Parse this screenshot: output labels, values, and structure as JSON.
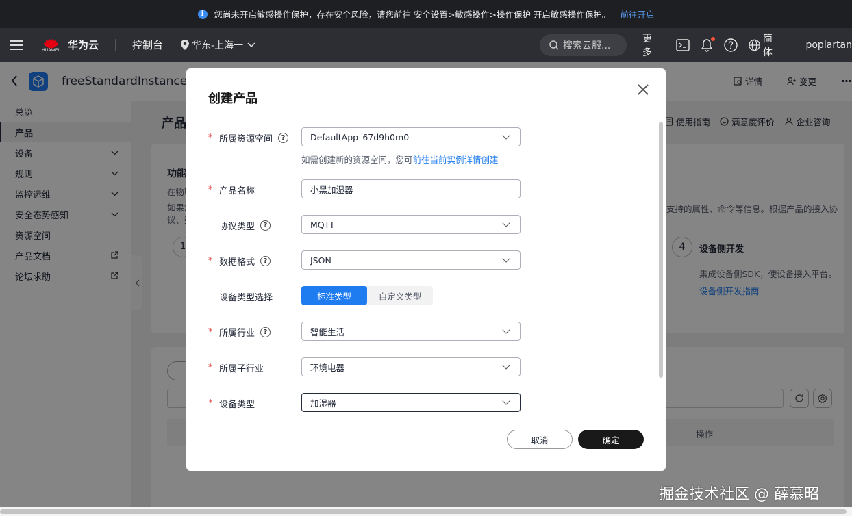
{
  "banner": {
    "message": "您尚未开启敏感操作保护，存在安全风险，请您前往 安全设置>敏感操作>操作保护 开启敏感操作保护。",
    "link": "前往开启",
    "accent": "#5b9cf2"
  },
  "nav": {
    "logo_text": "HUAWEI",
    "brand": "华为云",
    "console": "控制台",
    "region": "华东-上海一",
    "search_placeholder": "搜索云服...",
    "more": "更多",
    "language": "简体",
    "user": "poplartan"
  },
  "subheader": {
    "instance_name": "freeStandardInstance",
    "detail": "详情",
    "change": "变更"
  },
  "sidebar": {
    "items": [
      {
        "label": "总览"
      },
      {
        "label": "产品"
      },
      {
        "label": "设备"
      },
      {
        "label": "规则"
      },
      {
        "label": "监控运维"
      },
      {
        "label": "安全态势感知"
      },
      {
        "label": "资源空间"
      },
      {
        "label": "产品文档"
      },
      {
        "label": "论坛求助"
      }
    ]
  },
  "main": {
    "title": "产品",
    "links": [
      "使用指南",
      "满意度评价",
      "企业咨询"
    ],
    "feature_title": "功能",
    "feature_desc": "在物联",
    "feature_desc2_line1": "如果您",
    "feature_desc2_line2": "议、数",
    "right_desc": "支持的属性、命令等信息。根据产品的接入协",
    "step1": "1",
    "step4": "4",
    "step4_title": "设备侧开发",
    "step4_desc": "集成设备侧SDK，使设备接入平台。",
    "step4_link": "设备侧开发指南",
    "table_ops": "操作"
  },
  "modal": {
    "title": "创建产品",
    "fields": {
      "space": {
        "label": "所属资源空间",
        "value": "DefaultApp_67d9h0m0"
      },
      "name": {
        "label": "产品名称",
        "value": "小黑加湿器"
      },
      "protocol": {
        "label": "协议类型",
        "value": "MQTT"
      },
      "format": {
        "label": "数据格式",
        "value": "JSON"
      },
      "devtype_select": {
        "label": "设备类型选择",
        "options": [
          "标准类型",
          "自定义类型"
        ]
      },
      "industry": {
        "label": "所属行业",
        "value": "智能生活"
      },
      "subindustry": {
        "label": "所属子行业",
        "value": "环境电器"
      },
      "devtype": {
        "label": "设备类型",
        "value": "加湿器"
      }
    },
    "hint_prefix": "如需创建新的资源空间，您可",
    "hint_link": "前往当前实例详情创建",
    "required_mark": "*",
    "help_mark": "?",
    "cancel": "取消",
    "ok": "确定"
  },
  "watermark": "掘金技术社区 @ 薛慕昭"
}
